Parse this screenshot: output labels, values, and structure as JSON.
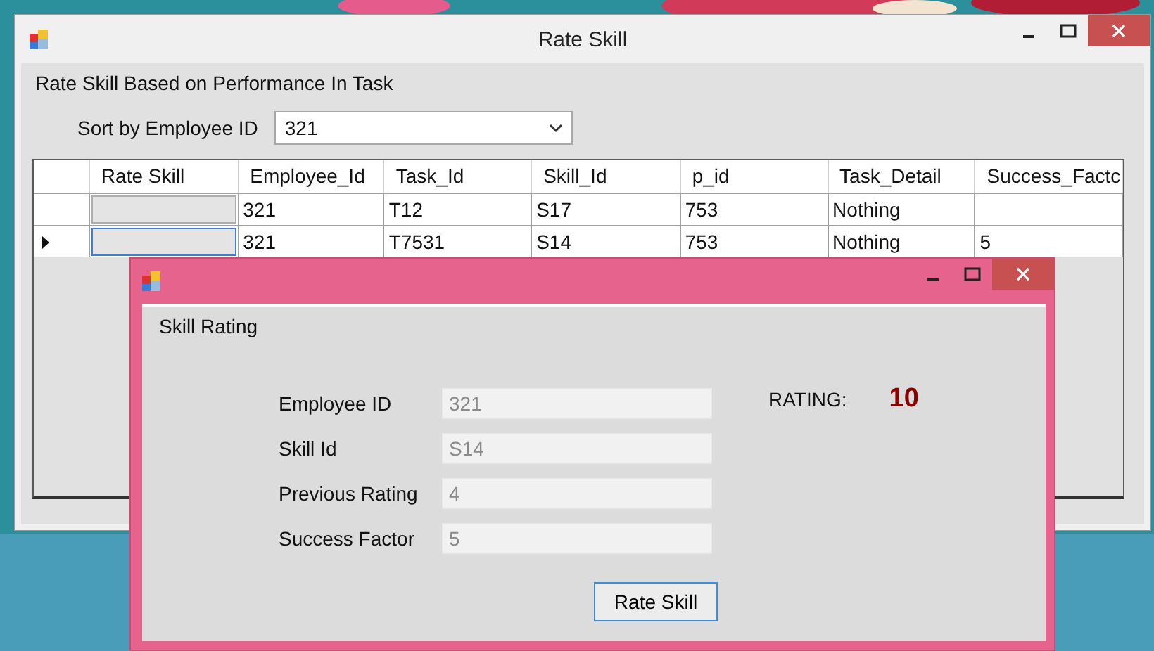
{
  "window": {
    "title": "Rate Skill"
  },
  "heading": "Rate Skill Based on Performance In Task",
  "sort": {
    "label": "Sort by Employee ID",
    "value": "321"
  },
  "table": {
    "columns": [
      "",
      "Rate Skill",
      "Employee_Id",
      "Task_Id",
      "Skill_Id",
      "p_id",
      "Task_Detail",
      "Success_Factc"
    ],
    "rows": [
      {
        "selected": false,
        "cells": [
          "",
          "",
          "321",
          "T12",
          "S17",
          "753",
          "Nothing",
          ""
        ]
      },
      {
        "selected": true,
        "cells": [
          "",
          "",
          "321",
          "T7531",
          "S14",
          "753",
          "Nothing",
          "5"
        ]
      }
    ]
  },
  "dialog": {
    "group_label": "Skill Rating",
    "fields": [
      {
        "label": "Employee ID",
        "value": "321",
        "disabled": true
      },
      {
        "label": "Skill Id",
        "value": "S14",
        "disabled": true
      },
      {
        "label": "Previous Rating",
        "value": "4",
        "disabled": true
      },
      {
        "label": "Success Factor",
        "value": "5",
        "disabled": true
      }
    ],
    "rating": {
      "label": "RATING:",
      "value": "10"
    },
    "button": "Rate Skill"
  }
}
